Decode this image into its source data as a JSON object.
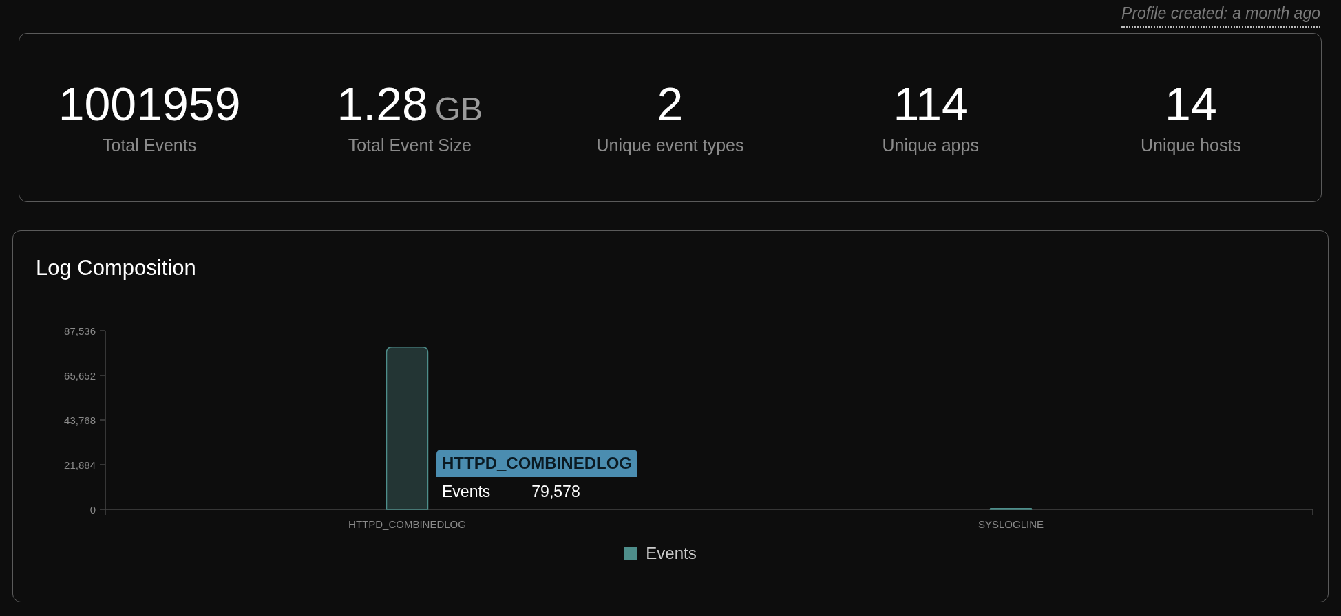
{
  "profile_created": "Profile created: a month ago",
  "stats": [
    {
      "value": "1001959",
      "label": "Total Events"
    },
    {
      "value": "1.28",
      "unit": "GB",
      "label": "Total Event Size"
    },
    {
      "value": "2",
      "label": "Unique event types"
    },
    {
      "value": "114",
      "label": "Unique apps"
    },
    {
      "value": "14",
      "label": "Unique hosts"
    }
  ],
  "log_composition": {
    "title": "Log Composition",
    "chart_data": {
      "type": "bar",
      "categories": [
        "HTTPD_COMBINEDLOG",
        "SYSLOGLINE"
      ],
      "series": [
        {
          "name": "Events",
          "color": "#4e8e8b",
          "values": [
            79578,
            400
          ]
        }
      ],
      "ylim": [
        0,
        87536
      ],
      "yticks": [
        {
          "value": 0,
          "label": "0"
        },
        {
          "value": 21884,
          "label": "21,884"
        },
        {
          "value": 43768,
          "label": "43,768"
        },
        {
          "value": 65652,
          "label": "65,652"
        },
        {
          "value": 87536,
          "label": "87,536"
        }
      ]
    },
    "tooltip": {
      "title": "HTTPD_COMBINEDLOG",
      "label": "Events",
      "value": "79,578"
    }
  }
}
